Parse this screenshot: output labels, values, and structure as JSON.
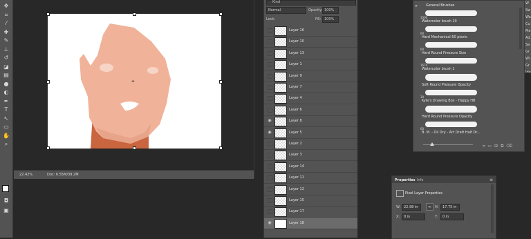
{
  "tools": [
    "move-tool",
    "crop-tool",
    "eyedropper-tool",
    "healing-brush-tool",
    "brush-tool",
    "clone-stamp-tool",
    "history-brush-tool",
    "eraser-tool",
    "gradient-tool",
    "blur-tool",
    "dodge-tool",
    "pen-tool",
    "type-tool",
    "path-selection-tool",
    "shape-tool",
    "hand-tool",
    "zoom-tool"
  ],
  "status": {
    "zoom": "22.42%",
    "doc": "Doc: 6.55M/39.2M"
  },
  "layers_panel": {
    "kind_label": "Kind",
    "blend_mode": "Normal",
    "opacity_label": "Opacity:",
    "opacity_value": "100%",
    "lock_label": "Lock:",
    "fill_label": "Fill:",
    "fill_value": "100%",
    "layers": [
      {
        "name": "Layer 16",
        "visible": false
      },
      {
        "name": "Layer 10",
        "visible": false
      },
      {
        "name": "Layer 13",
        "visible": false
      },
      {
        "name": "Layer 1",
        "visible": false
      },
      {
        "name": "Layer 9",
        "visible": false
      },
      {
        "name": "Layer 7",
        "visible": false
      },
      {
        "name": "Layer 4",
        "visible": false
      },
      {
        "name": "Layer 6",
        "visible": false
      },
      {
        "name": "Layer 8",
        "visible": true
      },
      {
        "name": "Layer 5",
        "visible": true
      },
      {
        "name": "Layer 2",
        "visible": false
      },
      {
        "name": "Layer 3",
        "visible": false
      },
      {
        "name": "Layer 14",
        "visible": false
      },
      {
        "name": "Layer 11",
        "visible": false
      },
      {
        "name": "Layer 12",
        "visible": false
      },
      {
        "name": "Layer 15",
        "visible": false
      },
      {
        "name": "Layer 17",
        "visible": false
      },
      {
        "name": "Layer 18",
        "visible": true,
        "selected": true
      }
    ]
  },
  "brushes_panel": {
    "group_name": "General Brushes",
    "brushes": [
      {
        "size": "1000",
        "name": "Watercolor brush 10"
      },
      {
        "size": "60",
        "name": "Hard Mechanical 60 pixels"
      },
      {
        "size": "60",
        "name": "Hard Round Pressure Size"
      },
      {
        "size": "1674",
        "name": "Watercolor brush 1"
      },
      {
        "size": "",
        "name": "Soft Round Pressure Opacity"
      },
      {
        "size": "30",
        "name": "Kyle's Drawing Box - Happy HB"
      },
      {
        "size": "",
        "name": "Hard Round Pressure Opacity"
      },
      {
        "size": "60",
        "name": "B. M. - Oil Dry - Art Draft Half Dr..."
      }
    ]
  },
  "right_narrow_labels": [
    "W",
    "Sw",
    "Wa",
    "Cu",
    "Ma",
    "Ad",
    "Sa",
    "Gr",
    "Wi",
    "Gr",
    "Ide"
  ],
  "properties_panel": {
    "tab_properties": "Properties",
    "tab_info": "Info",
    "title": "Pixel Layer Properties",
    "w_label": "W:",
    "w_value": "22.98 in",
    "h_label": "H:",
    "h_value": "17.75 in",
    "x_label": "X:",
    "x_value": "0 in",
    "y_label": "Y:",
    "y_value": "0 in"
  },
  "colors": {
    "skin": "#f0b39a",
    "shirt": "#c9663f",
    "panel": "#535353",
    "app_bg": "#282828"
  }
}
